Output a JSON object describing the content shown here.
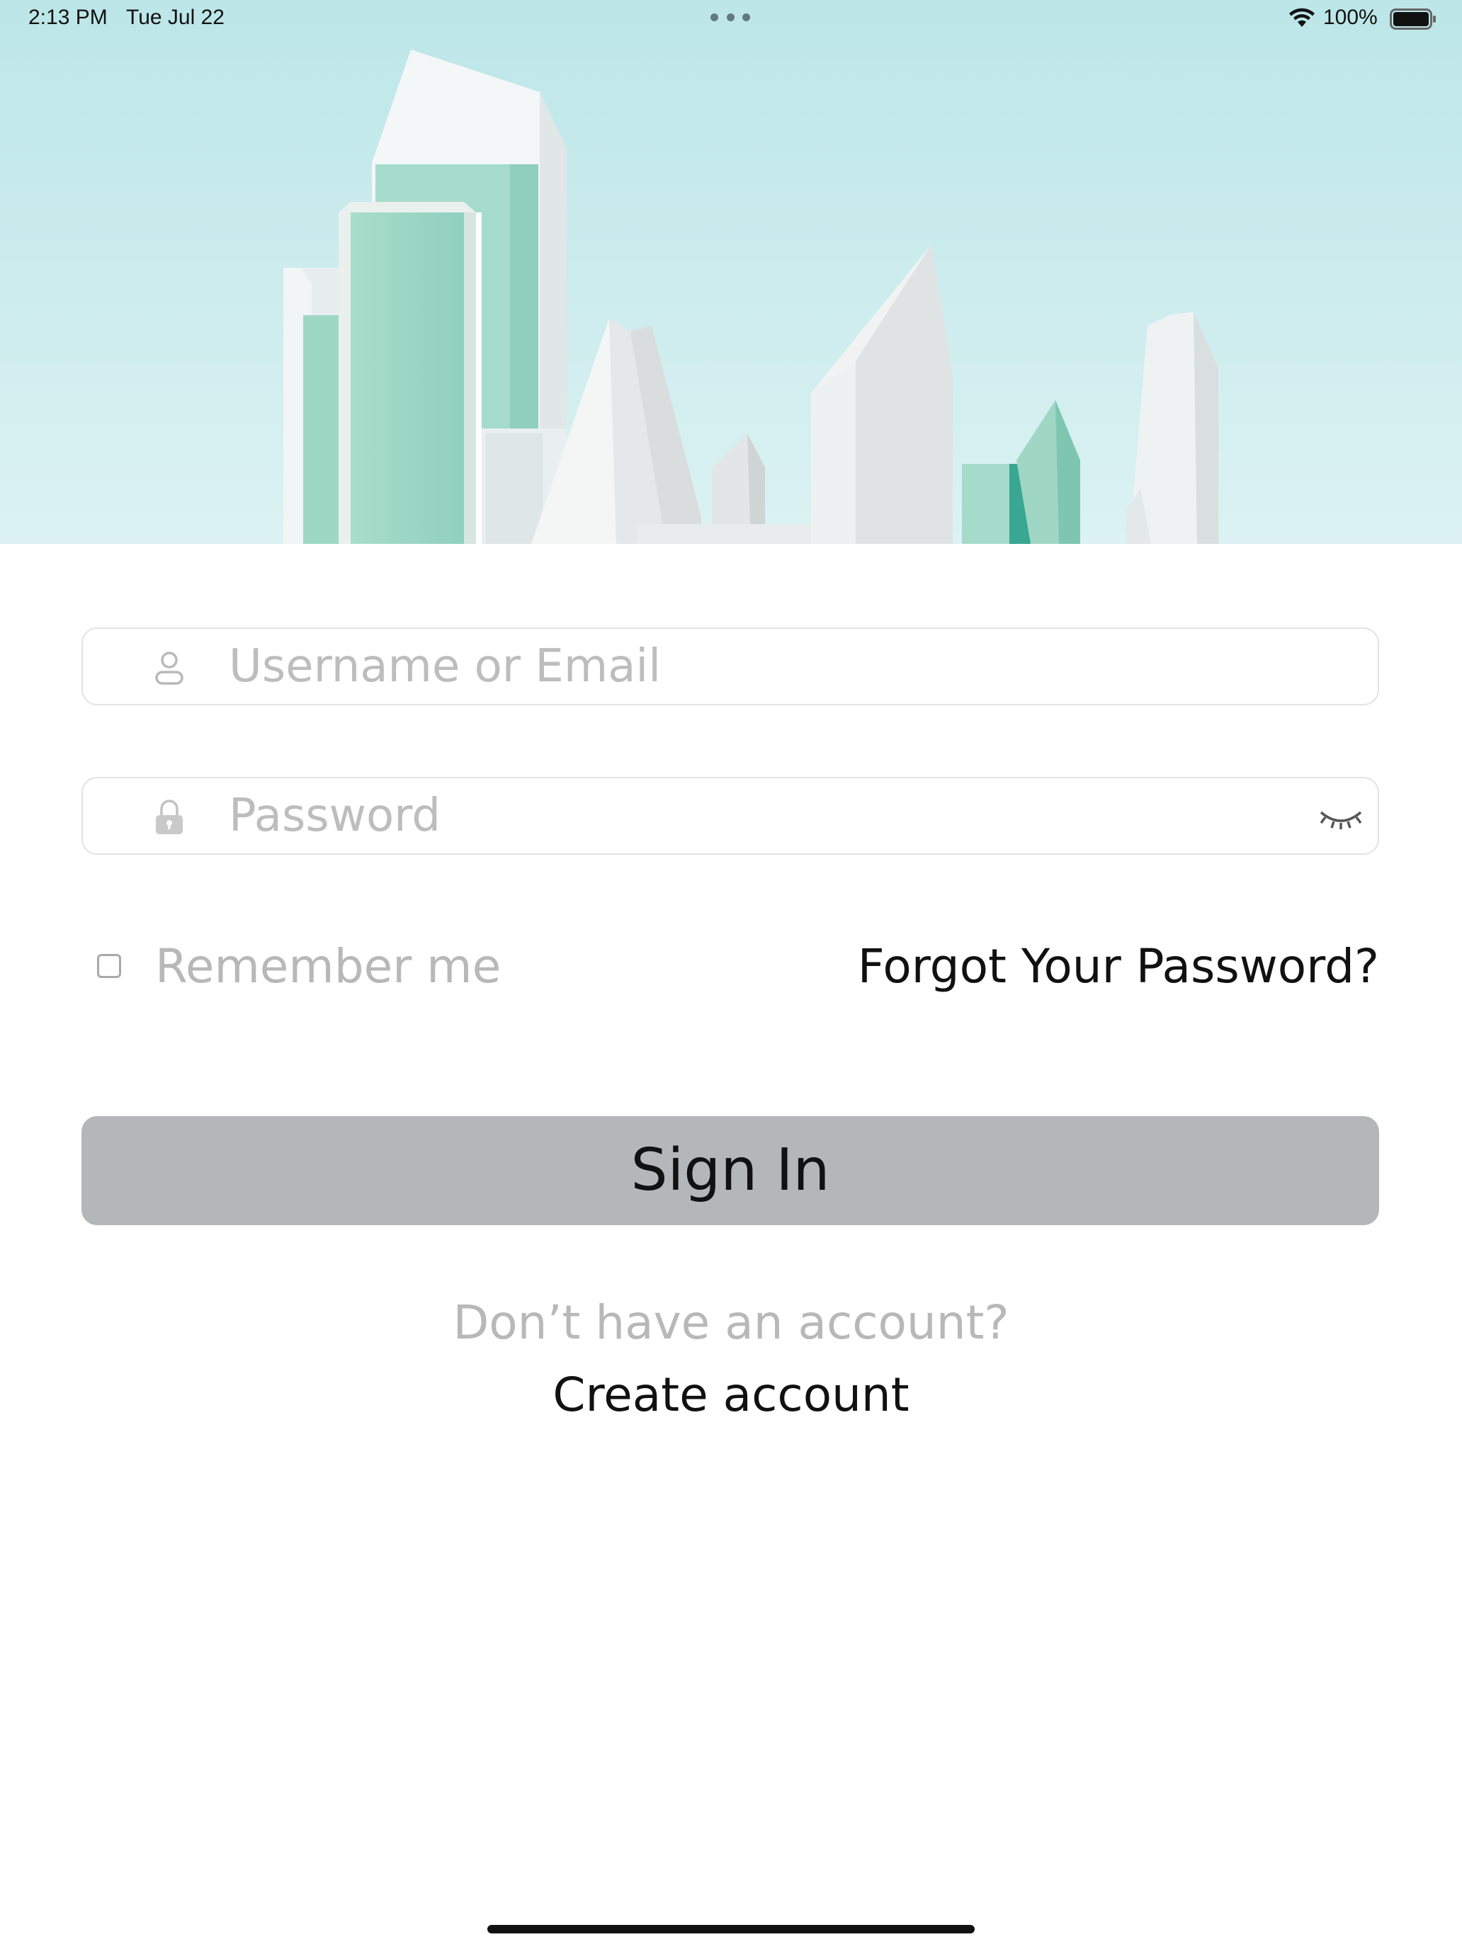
{
  "status_bar": {
    "time": "2:13 PM",
    "date": "Tue Jul 22",
    "battery": "100%",
    "icons": [
      "wifi-icon",
      "battery-icon",
      "multitask-dots-icon"
    ]
  },
  "hero": {
    "description_icon": "city-skyline-illustration",
    "colors": {
      "sky_top": "#bde7e9",
      "sky_bottom": "#d9f1f2",
      "mint": "#9fd8c6",
      "mint_dark": "#3fae98",
      "building_white": "#f1f3f3",
      "building_gray": "#dcdfe0"
    }
  },
  "login_form": {
    "username_placeholder": "Username or Email",
    "password_placeholder": "Password",
    "username_icon": "user-icon",
    "password_icon": "lock-icon",
    "password_toggle_icon": "eye-closed-icon",
    "remember_label": "Remember me",
    "remember_checked": false,
    "forgot_label": "Forgot Your Password?",
    "signin_label": "Sign In"
  },
  "signup": {
    "prompt": "Don’t have an account?",
    "link_label": "Create account"
  },
  "colors": {
    "button_bg": "#b5b6b8",
    "placeholder": "#bdbdbd",
    "field_border": "#e3e3e3",
    "text_primary": "#111111"
  }
}
